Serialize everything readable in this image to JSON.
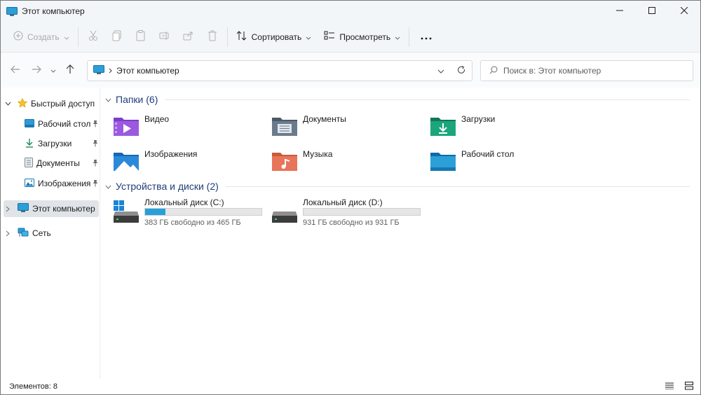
{
  "window": {
    "title": "Этот компьютер",
    "controls": [
      "minimize-icon",
      "maximize-icon",
      "close-icon"
    ]
  },
  "toolbar": {
    "create_label": "Создать",
    "sort_label": "Сортировать",
    "view_label": "Просмотреть",
    "icons": [
      "cut-icon",
      "copy-icon",
      "paste-icon",
      "rename-icon",
      "share-icon",
      "delete-icon",
      "more-icon"
    ]
  },
  "nav": {
    "address_text": "Этот компьютер",
    "search_placeholder": "Поиск в: Этот компьютер"
  },
  "sidebar": {
    "quick_access": "Быстрый доступ",
    "items": [
      {
        "label": "Рабочий стол",
        "icon": "desktop-icon"
      },
      {
        "label": "Загрузки",
        "icon": "downloads-icon"
      },
      {
        "label": "Документы",
        "icon": "documents-icon"
      },
      {
        "label": "Изображения",
        "icon": "pictures-icon"
      }
    ],
    "this_pc": "Этот компьютер",
    "network": "Сеть"
  },
  "content": {
    "folders_header": "Папки (6)",
    "folders": [
      {
        "label": "Видео",
        "icon": "videos-folder-icon"
      },
      {
        "label": "Документы",
        "icon": "documents-folder-icon"
      },
      {
        "label": "Загрузки",
        "icon": "downloads-folder-icon"
      },
      {
        "label": "Изображения",
        "icon": "pictures-folder-icon"
      },
      {
        "label": "Музыка",
        "icon": "music-folder-icon"
      },
      {
        "label": "Рабочий стол",
        "icon": "desktop-folder-icon"
      }
    ],
    "drives_header": "Устройства и диски (2)",
    "drives": [
      {
        "label": "Локальный диск (C:)",
        "free": "383 ГБ свободно из 465 ГБ",
        "used_fraction": 0.176,
        "icon": "system-drive-icon"
      },
      {
        "label": "Локальный диск (D:)",
        "free": "931 ГБ свободно из 931 ГБ",
        "used_fraction": 0.0,
        "icon": "drive-icon"
      }
    ]
  },
  "status": {
    "items_count": "Элементов: 8"
  },
  "colors": {
    "accent": "#26a0da",
    "group_header": "#1f3d7a",
    "selected_bg": "#e0e4e8"
  }
}
